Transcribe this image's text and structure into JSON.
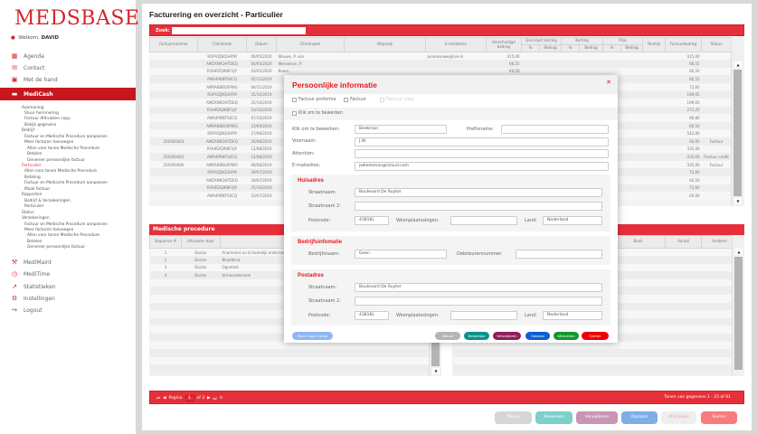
{
  "app": {
    "logo": "MEDSBASE",
    "welcome_prefix": "Welkom,",
    "user": "DAVID"
  },
  "nav": [
    {
      "label": "Agenda",
      "icon": "calendar-icon"
    },
    {
      "label": "Contact",
      "icon": "contact-icon"
    },
    {
      "label": "Met de hand",
      "icon": "hand-calendar-icon"
    },
    {
      "label": "MediCash",
      "icon": "wallet-icon"
    }
  ],
  "submenu": [
    [
      "Aanmaning",
      0
    ],
    [
      "Stuur herinnering",
      1
    ],
    [
      "Factuur Afdrukken copy",
      1
    ],
    [
      "Bekijk gegevens",
      1
    ],
    [
      "Bedrijf",
      0
    ],
    [
      "Factuur en Medische Procedure aanpassen",
      1
    ],
    [
      "Meer facturen toevoegen",
      1
    ],
    [
      "Allen voor tonen Medische Procedure",
      2
    ],
    [
      "Betalen",
      2
    ],
    [
      "Genereer persoonlijke factuur",
      2
    ],
    [
      "Particulier",
      0
    ],
    [
      "Allen voor tonen Medische Procedure",
      1
    ],
    [
      "Betaling",
      1
    ],
    [
      "Factuur en Medische Procedure aanpassen",
      1
    ],
    [
      "Maak factuur",
      1
    ],
    [
      "Rapporten",
      0
    ],
    [
      "Bedrijf & Verzekeringen",
      1
    ],
    [
      "Particulier",
      1
    ],
    [
      "Status",
      0
    ],
    [
      "Verzekeringen",
      0
    ],
    [
      "Factuur en Medische Procedure aanpassen",
      1
    ],
    [
      "Meer facturen toevoegen",
      1
    ],
    [
      "Allen voor tonen Medische Procedure",
      2
    ],
    [
      "Betalen",
      2
    ],
    [
      "Genereer persoonlijke factuur",
      2
    ]
  ],
  "submenu_active": 10,
  "nav_bottom": [
    {
      "label": "MediMaint",
      "icon": "wrench-icon"
    },
    {
      "label": "MediTime",
      "icon": "clock-icon"
    },
    {
      "label": "Statistieken",
      "icon": "chart-icon"
    },
    {
      "label": "Instellingen",
      "icon": "settings-icon"
    },
    {
      "label": "Logout",
      "icon": "logout-icon"
    }
  ],
  "page": {
    "title": "Facturering en overzicht - Particulier",
    "search_label": "Zoek:",
    "search_value": ""
  },
  "table": {
    "headers": [
      "Factuurnummer",
      "Clientcode",
      "Datum",
      "Clientnaam",
      "Afspraak",
      "E-mailadres",
      "Verschuldigd bedrag",
      "Ges.kaart korting",
      "Korting",
      "Prijs",
      "Termijn",
      "Factuurbedrag",
      "Status"
    ],
    "sub_headers": [
      "%",
      "Bedrag"
    ],
    "rows": [
      [
        "",
        "ROPVZJBQSHYM",
        "06/05/2020",
        "Wouwe, P. van",
        "",
        "pvanwouwe@live.nl",
        "415,00",
        "415,00",
        ""
      ],
      [
        "",
        "AMZXNROHTDEQ",
        "04/05/2020",
        "Wesselson, P.",
        "",
        "",
        "66,55",
        "66,55",
        ""
      ],
      [
        "",
        "ROHRZQWBFUJY",
        "03/05/2020",
        "Baars,",
        "",
        "",
        "60,50",
        "60,50",
        ""
      ],
      [
        "",
        "AMA4PBNTS0CQ",
        "05/12/2019",
        "",
        "",
        "",
        "",
        "66,55",
        ""
      ],
      [
        "",
        "AMRAKBBUSPWG",
        "06/11/2019",
        "",
        "",
        "",
        "",
        "72,60",
        ""
      ],
      [
        "",
        "ROPVZJBQSHYM",
        "25/10/2019",
        "",
        "",
        "",
        "",
        "199,65",
        ""
      ],
      [
        "",
        "AMZXNROHTDEQ",
        "25/10/2019",
        "",
        "",
        "",
        "",
        "199,65",
        ""
      ],
      [
        "",
        "ROHRZQWBFUJY",
        "10/10/2019",
        "",
        "",
        "",
        "",
        "272,25",
        ""
      ],
      [
        "",
        "AMA4PBNTS0CQ",
        "07/10/2019",
        "",
        "",
        "",
        "",
        "96,80",
        ""
      ],
      [
        "",
        "AMRAKBBUSPWG",
        "23/09/2019",
        "",
        "",
        "",
        "",
        "60,50",
        ""
      ],
      [
        "",
        "ROPVZJBQSHYM",
        "27/08/2019",
        "",
        "",
        "",
        "",
        "542,00",
        ""
      ],
      [
        "201900403",
        "AMZXNROHTDEQ",
        "26/08/2019",
        "",
        "",
        "",
        "",
        "60,00",
        "Factuur"
      ],
      [
        "",
        "ROHRZQWBFUJY",
        "12/08/2019",
        "",
        "",
        "",
        "",
        "335,00",
        ""
      ],
      [
        "201900401",
        "AMA4PBNTS0CQ",
        "12/08/2019",
        "",
        "",
        "",
        "",
        "-335,00",
        "Factuur credit"
      ],
      [
        "201900400",
        "AMRAKBBUSPWG",
        "08/08/2019",
        "",
        "",
        "",
        "",
        "335,00",
        "Factuur"
      ],
      [
        "",
        "ROPVZJBQSHYM",
        "29/07/2019",
        "",
        "",
        "",
        "",
        "72,60",
        ""
      ],
      [
        "",
        "AMZXNROHTDEQ",
        "29/07/2019",
        "",
        "",
        "",
        "",
        "60,50",
        ""
      ],
      [
        "",
        "ROHRZQWBFUJY",
        "25/10/2019",
        "",
        "",
        "",
        "",
        "72,60",
        ""
      ],
      [
        "",
        "AMA4PBNTS0CQ",
        "10/07/2019",
        "",
        "",
        "",
        "",
        "60,00",
        ""
      ]
    ]
  },
  "procedures": {
    "title": "Medische procedure",
    "headers": [
      "Sequence #",
      "Uitvoeren door",
      "Naam Medische procedure"
    ],
    "rows": [
      [
        "1",
        "Doctor",
        "Anamnese en lichamelijk onderzoek"
      ],
      [
        "2",
        "Doctor",
        "Bloeddruk"
      ],
      [
        "3",
        "Doctor",
        "Ogentest"
      ],
      [
        "4",
        "Doctor",
        "Urineonderzoek"
      ]
    ]
  },
  "right_panel": {
    "headers": [
      "Bank",
      "Aantal",
      "Andoren"
    ]
  },
  "pager": {
    "page_label": "Pagina",
    "page": "1",
    "of": "of 3",
    "summary": "Tonen van gegevens 1 - 25 of 61"
  },
  "actions": [
    {
      "label": "Nieuw",
      "color": "#d6d6d6",
      "text": "#fff"
    },
    {
      "label": "Bewerken",
      "color": "#7ccfcb",
      "text": "#fff"
    },
    {
      "label": "Verwijderen",
      "color": "#c995b5",
      "text": "#fff"
    },
    {
      "label": "Opslaan",
      "color": "#7eaee8",
      "text": "#fff"
    },
    {
      "label": "Afdrukken",
      "color": "#eeeeee",
      "text": "#f2a0a0"
    },
    {
      "label": "Sluiten",
      "color": "#f77b7f",
      "text": "#fff"
    }
  ],
  "modal": {
    "title": "Persoonlijke informatie",
    "checks": [
      "Factuur proforma",
      "Factuur",
      "Factuur copy",
      "Klik om te bewerken"
    ],
    "labels": {
      "achternaam": "Klik om te bewerken:",
      "prefix": "Prefixname:",
      "voornaam": "Voornaam:",
      "attention": "Attention:",
      "email": "E-mailadres:"
    },
    "values": {
      "achternaam": "Beekman",
      "prefix": "",
      "voornaam": "J.W.",
      "attention": "",
      "email": "jwbeekman@icloud.com"
    },
    "huisadres": {
      "title": "Huisadres",
      "straat_label": "Straatnaam:",
      "straat": "Boulevard De Ruyter",
      "straat2_label": "Straatnaam 2:",
      "straat2": "",
      "postcode_label": "Postcode:",
      "postcode": "4381KL",
      "plaats_label": "Woonplaatssingen:",
      "plaats": "",
      "land_label": "Land:",
      "land": "Nederland"
    },
    "bedrijf": {
      "title": "Bedrijfsinfomatie",
      "naam_label": "Bedrijfsnaam:",
      "naam": "Geen",
      "deb_label": "Debiteurennummer:",
      "deb": ""
    },
    "postadres": {
      "title": "Postadres",
      "straat_label": "Straatnaam:",
      "straat": "Boulevard De Ruyter",
      "straat2_label": "Straatnaam 2:",
      "straat2": "",
      "postcode_label": "Postcode:",
      "postcode": "4381KL",
      "plaats_label": "Woonplaatssingen:",
      "plaats": "",
      "land_label": "Land:",
      "land": "Nederland"
    },
    "mail_button": "Stuur naar e-mail",
    "buttons": [
      {
        "label": "Nieuw",
        "color": "#b5b5b5"
      },
      {
        "label": "Bewerken",
        "color": "#0e918b"
      },
      {
        "label": "Verwijderen",
        "color": "#8e1f5a"
      },
      {
        "label": "Opslaan",
        "color": "#0d5fcf"
      },
      {
        "label": "Afdrukken",
        "color": "#14962f"
      },
      {
        "label": "Sluiten",
        "color": "#f00000"
      }
    ]
  },
  "colors": {
    "brand": "#d4252b",
    "header_red": "#e5303a"
  }
}
